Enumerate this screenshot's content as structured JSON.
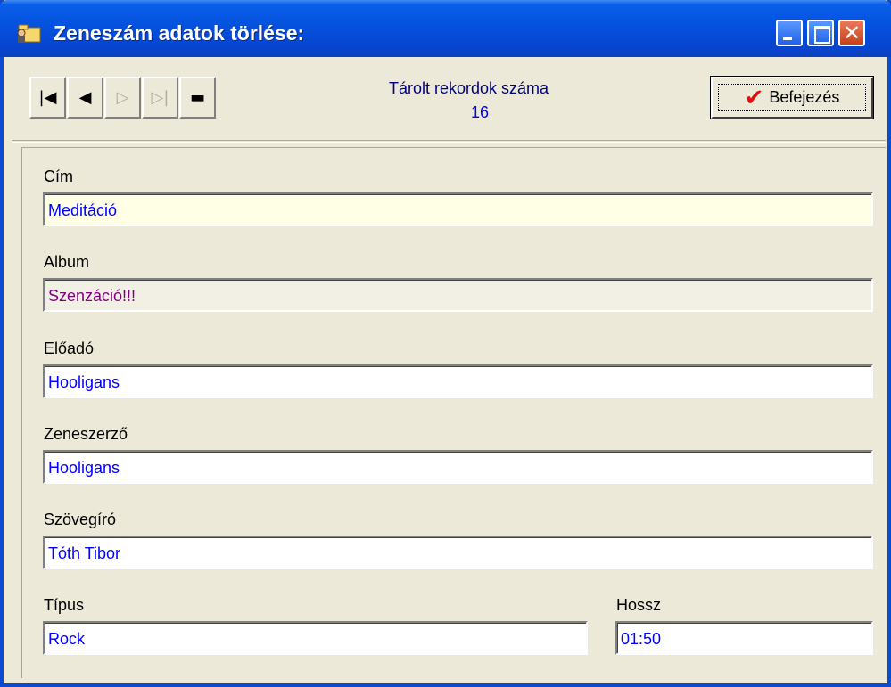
{
  "window": {
    "title": "Zeneszám adatok törlése:",
    "close_glyph": "✕"
  },
  "toolbar": {
    "nav": [
      {
        "name": "first-record-button",
        "glyph": "|◀",
        "enabled": true
      },
      {
        "name": "prev-record-button",
        "glyph": "◀",
        "enabled": true
      },
      {
        "name": "next-record-button",
        "glyph": "▷",
        "enabled": false
      },
      {
        "name": "last-record-button",
        "glyph": "▷|",
        "enabled": false
      },
      {
        "name": "delete-record-button",
        "glyph": "▬",
        "enabled": true
      }
    ],
    "record_label": "Tárolt rekordok száma",
    "record_count": "16",
    "finish_label": "Befejezés",
    "finish_icon": "check-icon"
  },
  "form": {
    "cim": {
      "label": "Cím",
      "value": "Meditáció"
    },
    "album": {
      "label": "Album",
      "value": "Szenzáció!!!"
    },
    "eloado": {
      "label": "Előadó",
      "value": "Hooligans"
    },
    "zeneszerzo": {
      "label": "Zeneszerző",
      "value": "Hooligans"
    },
    "szovegiro": {
      "label": "Szövegíró",
      "value": "Tóth Tibor"
    },
    "tipus": {
      "label": "Típus",
      "value": "Rock"
    },
    "hossz": {
      "label": "Hossz",
      "value": "01:50"
    }
  },
  "colors": {
    "titlebar": "#0548d6",
    "field_text": "#0000ff",
    "album_text": "#800080",
    "highlight_field": "#ffffe6",
    "check": "#e01010"
  }
}
